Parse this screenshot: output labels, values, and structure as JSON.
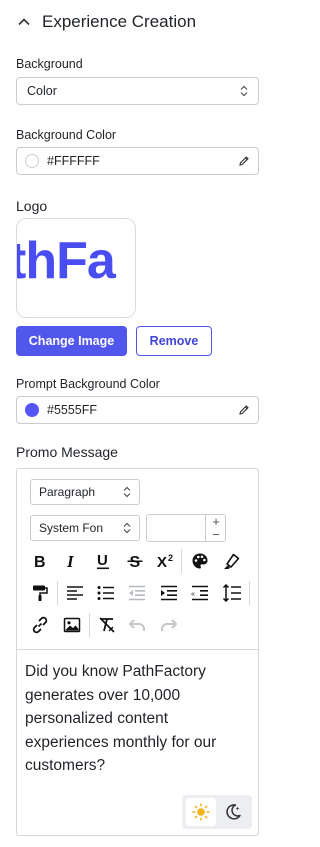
{
  "section": {
    "title": "Experience Creation"
  },
  "background": {
    "label": "Background",
    "value": "Color"
  },
  "background_color": {
    "label": "Background Color",
    "value": "#FFFFFF",
    "swatch": "#FFFFFF"
  },
  "logo": {
    "label": "Logo",
    "image_text": "thFa",
    "image_color": "#4A4EF2",
    "change_button": "Change Image",
    "remove_button": "Remove"
  },
  "prompt_bg": {
    "label": "Prompt Background Color",
    "value": "#5555FF",
    "swatch": "#5555FF"
  },
  "promo": {
    "label": "Promo Message",
    "block_format": "Paragraph",
    "font_family": "System Fon",
    "font_size": "",
    "toolbar": [
      "bold-icon",
      "italic-icon",
      "underline-icon",
      "strikethrough-icon",
      "superscript-icon",
      "palette-icon",
      "highlighter-icon",
      "paint-roller-icon",
      "align-left-icon",
      "bulleted-list-icon",
      "outdent-icon",
      "indent-icon",
      "text-direction-icon",
      "line-height-icon",
      "link-icon",
      "image-icon",
      "clear-formatting-icon",
      "undo-icon",
      "redo-icon"
    ],
    "content": "Did you know PathFactory generates over 10,000 personalized content experiences monthly for our customers?",
    "theme": {
      "light": "sun-icon",
      "dark": "moon-icon",
      "active": "light"
    }
  },
  "colors": {
    "accent": "#5157EC",
    "border": "#C9CCD1",
    "text": "#1F2328"
  }
}
